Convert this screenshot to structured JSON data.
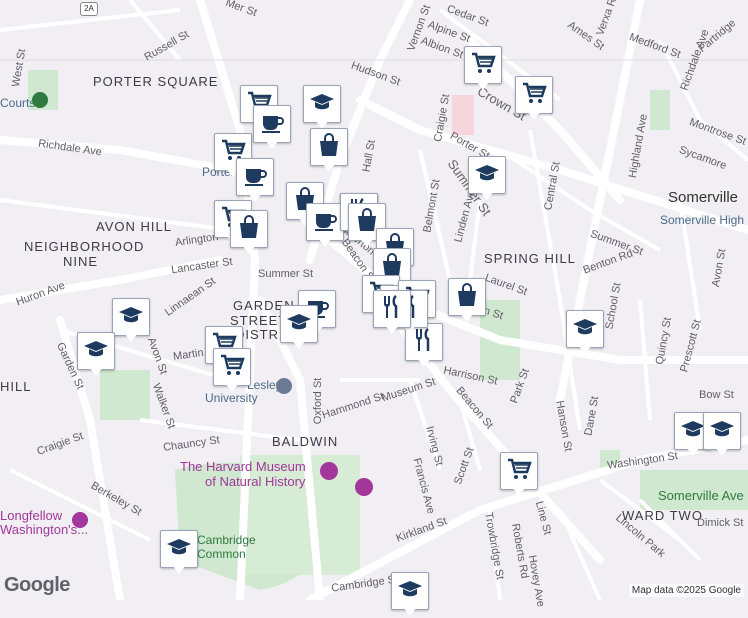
{
  "map": {
    "area_labels": [
      {
        "text": "PORTER SQUARE"
      },
      {
        "text": "AVON HILL"
      },
      {
        "text": "NEIGHBORHOOD"
      },
      {
        "text": "NINE"
      },
      {
        "text": "SPRING HILL"
      },
      {
        "text": "BALDWIN"
      },
      {
        "text": "WARD TWO"
      },
      {
        "text": "HILL"
      },
      {
        "text": "GARDEN"
      },
      {
        "text": "STREET"
      },
      {
        "text": "DISTRICT"
      }
    ],
    "city_labels": [
      {
        "text": "Somerville"
      }
    ],
    "street_labels": [
      "Russell St",
      "Summer St",
      "Richdale Ave",
      "Arlington",
      "Lancaster St",
      "Linnaean St",
      "Huron Ave",
      "Garden St",
      "Avon St",
      "Walker St",
      "Martin St",
      "Chauncy St",
      "Craigie St",
      "Berkeley St",
      "Hammond St",
      "Oxford St",
      "Museum St",
      "Irving St",
      "Francis Ave",
      "Scott St",
      "Kirkland St",
      "Cambridge St",
      "Trowbridge St",
      "Roberts Rd",
      "Hovey Ave",
      "Line St",
      "Beacon St",
      "Harrison St",
      "Park St",
      "Bow St",
      "Hanson St",
      "Dane St",
      "Washington St",
      "Adrian St",
      "Dimick St",
      "Lincoln Park",
      "Somerville Ave",
      "Atherton St",
      "Laurel St",
      "School St",
      "Quincy St",
      "Prescott St",
      "Avon St",
      "Summer St",
      "Benton Rd",
      "Central St",
      "Highland Ave",
      "Crown St",
      "Porter St",
      "Craigie St",
      "Belmont St",
      "Linden Ave",
      "Hall St",
      "Hudson St",
      "Albion St",
      "Alpine St",
      "Cedar St",
      "Vernon St",
      "Ames St",
      "Medford St",
      "Richdale Ave",
      "Montrose St",
      "Sycamore",
      "Partridge",
      "Verxa Rd",
      "West St",
      "Summer St",
      "Mer St"
    ],
    "poi_labels": [
      {
        "text": "Courts"
      },
      {
        "text": "Porter"
      },
      {
        "text": "Lesley"
      },
      {
        "text": "University"
      },
      {
        "text": "The Harvard Museum"
      },
      {
        "text": "of Natural History"
      },
      {
        "text": "Longfellow"
      },
      {
        "text": "Washington's..."
      },
      {
        "text": "Cambridge"
      },
      {
        "text": "Common"
      },
      {
        "text": "Somerville High Sc"
      }
    ],
    "markers": [
      {
        "icon": "shopping-cart-icon"
      },
      {
        "icon": "shopping-cart-icon"
      },
      {
        "icon": "shopping-cart-icon"
      },
      {
        "icon": "shopping-cart-icon"
      },
      {
        "icon": "coffee-cup-icon"
      },
      {
        "icon": "graduation-cap-icon"
      },
      {
        "icon": "shopping-bag-icon"
      },
      {
        "icon": "coffee-cup-icon"
      },
      {
        "icon": "shopping-cart-icon"
      },
      {
        "icon": "shopping-bag-icon"
      },
      {
        "icon": "shopping-bag-icon"
      },
      {
        "icon": "coffee-cup-icon"
      },
      {
        "icon": "restaurant-icon"
      },
      {
        "icon": "shopping-bag-icon"
      },
      {
        "icon": "shopping-bag-icon"
      },
      {
        "icon": "shopping-bag-icon"
      },
      {
        "icon": "shopping-bag-icon"
      },
      {
        "icon": "shopping-cart-icon"
      },
      {
        "icon": "restaurant-icon"
      },
      {
        "icon": "restaurant-icon"
      },
      {
        "icon": "shopping-cart-icon"
      },
      {
        "icon": "restaurant-icon"
      },
      {
        "icon": "shopping-bag-icon"
      },
      {
        "icon": "graduation-cap-icon"
      },
      {
        "icon": "graduation-cap-icon"
      },
      {
        "icon": "graduation-cap-icon"
      },
      {
        "icon": "graduation-cap-icon"
      },
      {
        "icon": "coffee-cup-icon"
      },
      {
        "icon": "graduation-cap-icon"
      },
      {
        "icon": "shopping-cart-icon"
      },
      {
        "icon": "shopping-cart-icon"
      },
      {
        "icon": "restaurant-icon"
      },
      {
        "icon": "graduation-cap-icon"
      },
      {
        "icon": "graduation-cap-icon"
      },
      {
        "icon": "graduation-cap-icon"
      },
      {
        "icon": "shopping-cart-icon"
      },
      {
        "icon": "graduation-cap-icon"
      }
    ],
    "highway_shield": "2A",
    "attribution": "Map data ©2025 Google",
    "logo": "Google"
  }
}
